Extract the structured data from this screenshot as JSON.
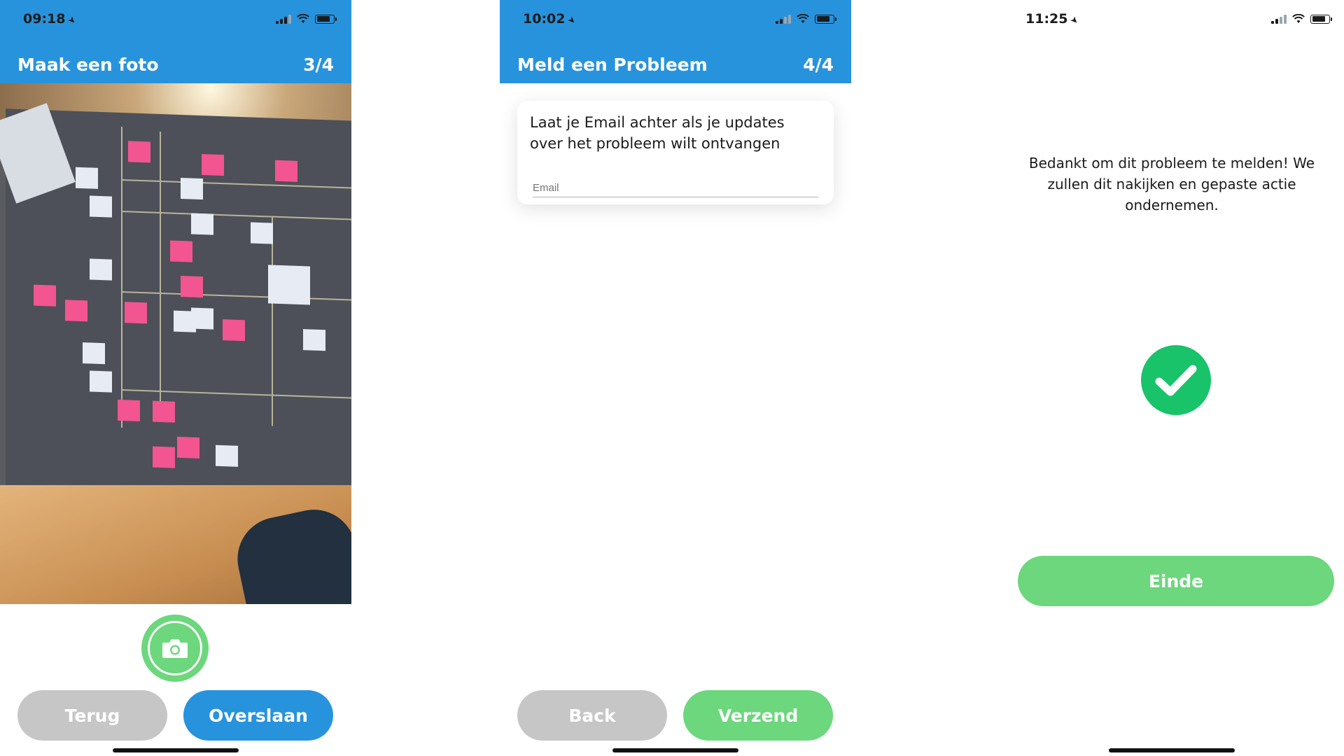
{
  "screen1": {
    "time": "09:18",
    "title": "Maak een foto",
    "step": "3/4",
    "back_label": "Terug",
    "skip_label": "Overslaan",
    "camera_icon": "camera-icon"
  },
  "screen2": {
    "time": "10:02",
    "title": "Meld een Probleem",
    "step": "4/4",
    "card_text": "Laat je Email achter als je updates over het probleem wilt ontvangen",
    "email_placeholder": "Email",
    "back_label": "Back",
    "send_label": "Verzend"
  },
  "screen3": {
    "time": "11:25",
    "message": "Bedankt om dit probleem te melden! We zullen dit nakijken en gepaste actie ondernemen.",
    "done_label": "Einde",
    "check_icon": "checkmark-icon"
  },
  "colors": {
    "header_blue": "#2893dd",
    "button_green": "#6cd77c",
    "button_grey": "#c6c6c6",
    "check_green": "#19c36a"
  }
}
